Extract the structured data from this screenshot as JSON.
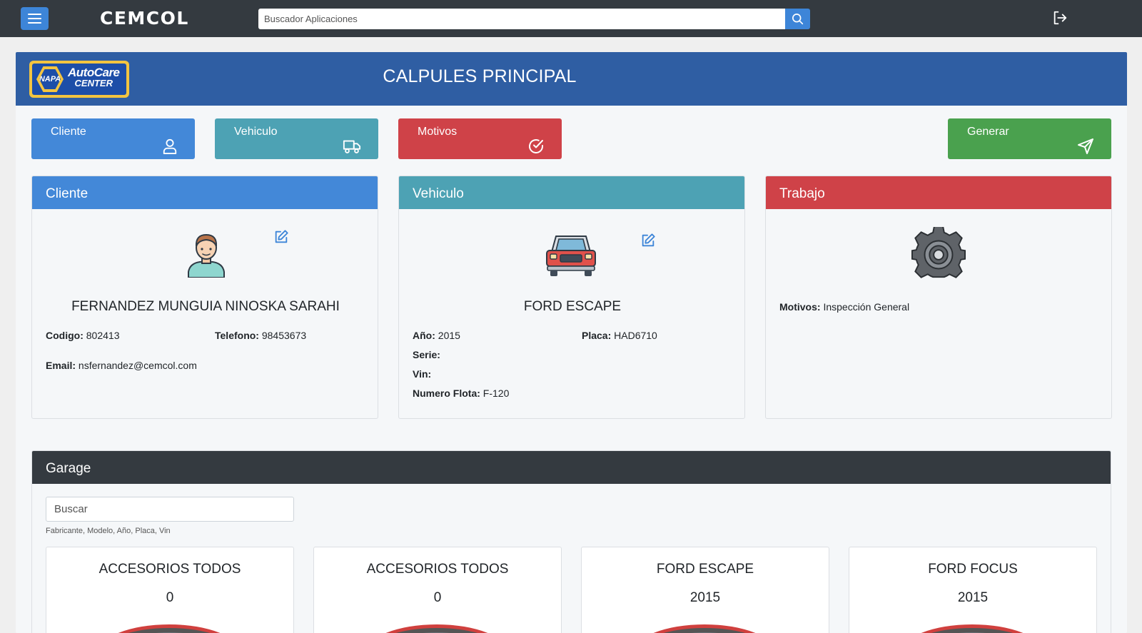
{
  "topbar": {
    "brand": "CEMCOL",
    "search_placeholder": "Buscador Aplicaciones"
  },
  "hero": {
    "title": "CALPULES PRINCIPAL",
    "logo_hex_text": "NAPA",
    "logo_line1": "AutoCare",
    "logo_line2": "CENTER"
  },
  "actions": {
    "cliente": "Cliente",
    "vehiculo": "Vehiculo",
    "motivos": "Motivos",
    "generar": "Generar"
  },
  "cliente_card": {
    "title": "Cliente",
    "name": "FERNANDEZ MUNGUIA NINOSKA SARAHI",
    "codigo_label": "Codigo:",
    "codigo": "802413",
    "telefono_label": "Telefono:",
    "telefono": "98453673",
    "email_label": "Email:",
    "email": "nsfernandez@cemcol.com"
  },
  "vehiculo_card": {
    "title": "Vehiculo",
    "name": "FORD ESCAPE",
    "anio_label": "Año:",
    "anio": "2015",
    "placa_label": "Placa:",
    "placa": "HAD6710",
    "serie_label": "Serie:",
    "serie": "",
    "vin_label": "Vin:",
    "vin": "",
    "flota_label": "Numero Flota:",
    "flota": "F-120"
  },
  "trabajo_card": {
    "title": "Trabajo",
    "motivos_label": "Motivos:",
    "motivos": "Inspección General"
  },
  "garage": {
    "title": "Garage",
    "search_placeholder": "Buscar",
    "hint": "Fabricante, Modelo, Año, Placa, Vin",
    "vehicles": [
      {
        "title": "ACCESORIOS TODOS",
        "sub": "0"
      },
      {
        "title": "ACCESORIOS TODOS",
        "sub": "0"
      },
      {
        "title": "FORD ESCAPE",
        "sub": "2015"
      },
      {
        "title": "FORD FOCUS",
        "sub": "2015"
      }
    ]
  },
  "colors": {
    "topbar": "#343a40",
    "primary": "#4388d8",
    "info": "#4da2b4",
    "danger": "#cf4248",
    "success": "#4aa14e",
    "hero": "#2f5ea3"
  }
}
